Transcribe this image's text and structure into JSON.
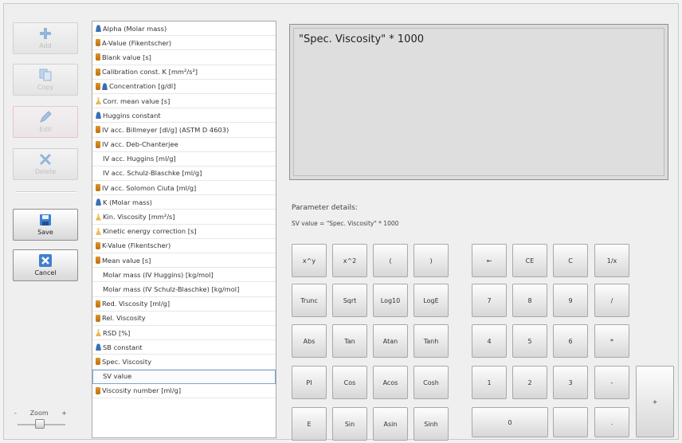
{
  "toolbar": {
    "add": "Add",
    "copy": "Copy",
    "edit": "Edit",
    "delete": "Delete",
    "save": "Save",
    "cancel": "Cancel"
  },
  "zoom": {
    "label": "Zoom",
    "minus": "-",
    "plus": "+"
  },
  "parameters": [
    {
      "icon": "user",
      "label": "Alpha (Molar mass)"
    },
    {
      "icon": "bottle",
      "label": "A-Value (Fikentscher)"
    },
    {
      "icon": "bottle",
      "label": "Blank value [s]"
    },
    {
      "icon": "bottle",
      "label": "Calibration const. K [mm²/s²]"
    },
    {
      "icon": "bottle-user",
      "label": "Concentration [g/dl]"
    },
    {
      "icon": "flask",
      "label": "Corr. mean value [s]"
    },
    {
      "icon": "user",
      "label": "Huggins constant"
    },
    {
      "icon": "bottle",
      "label": "IV acc. Billmeyer [dl/g] (ASTM D 4603)"
    },
    {
      "icon": "bottle",
      "label": "IV acc. Deb-Chanterjee"
    },
    {
      "icon": "blank",
      "label": "IV acc. Huggins [ml/g]"
    },
    {
      "icon": "blank",
      "label": "IV acc. Schulz-Blaschke [ml/g]"
    },
    {
      "icon": "bottle",
      "label": "IV acc. Solomon Ciuta [ml/g]"
    },
    {
      "icon": "user",
      "label": "K (Molar mass)"
    },
    {
      "icon": "flask",
      "label": "Kin. Viscosity [mm²/s]"
    },
    {
      "icon": "flask",
      "label": "Kinetic energy correction [s]"
    },
    {
      "icon": "bottle",
      "label": "K-Value (Fikentscher)"
    },
    {
      "icon": "bottle",
      "label": "Mean value [s]"
    },
    {
      "icon": "blank",
      "label": "Molar mass (IV Huggins) [kg/mol]"
    },
    {
      "icon": "blank",
      "label": "Molar mass (IV Schulz-Blaschke) [kg/mol]"
    },
    {
      "icon": "bottle",
      "label": "Red. Viscosity [ml/g]"
    },
    {
      "icon": "bottle",
      "label": "Rel. Viscosity"
    },
    {
      "icon": "flask",
      "label": "RSD [%]"
    },
    {
      "icon": "user",
      "label": "SB constant"
    },
    {
      "icon": "bottle",
      "label": "Spec. Viscosity"
    },
    {
      "icon": "blank",
      "label": "SV value",
      "selected": true
    },
    {
      "icon": "bottle",
      "label": "Viscosity number [ml/g]"
    }
  ],
  "formula": "\"Spec. Viscosity\" * 1000",
  "details": {
    "title": "Parameter details:",
    "text": "SV value =  \"Spec. Viscosity\" * 1000"
  },
  "keypad": {
    "func_rows": [
      [
        "x^y",
        "x^2",
        "(",
        ")"
      ],
      [
        "Trunc",
        "Sqrt",
        "Log10",
        "LogE"
      ],
      [
        "Abs",
        "Tan",
        "Atan",
        "Tanh"
      ],
      [
        "PI",
        "Cos",
        "Acos",
        "Cosh"
      ],
      [
        "E",
        "Sin",
        "Asin",
        "Sinh"
      ]
    ],
    "num_rows": [
      [
        "←",
        "CE",
        "C",
        "1/x"
      ],
      [
        "7",
        "8",
        "9",
        "/"
      ],
      [
        "4",
        "5",
        "6",
        "*"
      ],
      [
        "1",
        "2",
        "3",
        "-"
      ],
      [
        "0",
        "",
        "."
      ]
    ],
    "plus": "+",
    "equals": "="
  }
}
